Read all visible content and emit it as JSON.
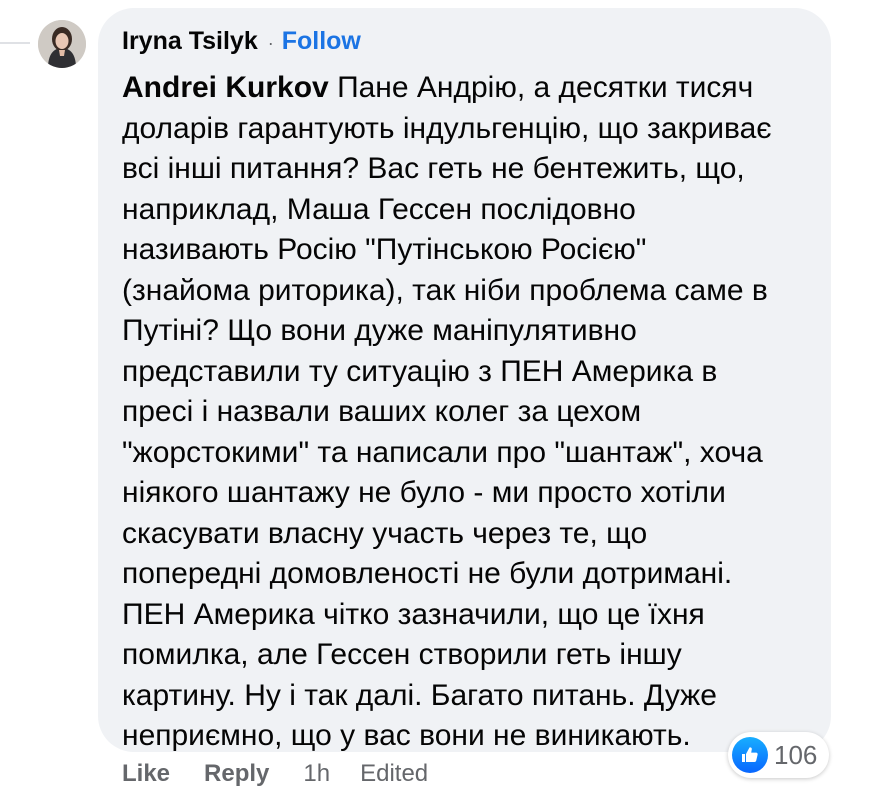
{
  "comment": {
    "author": "Iryna Tsilyk",
    "separator": "·",
    "follow_label": "Follow",
    "mention": "Andrei Kurkov",
    "lines": [
      "Пане Андрію, а десятки тисяч",
      "доларів гарантують індульгенцію, що закриває",
      "всі інші питання? Вас геть не бентежить, що,",
      "наприклад, Маша Гессен послідовно",
      "називають Росію \"Путінською Росією\"",
      "(знайома риторика), так ніби проблема саме в",
      "Путіні? Що вони дуже маніпулятивно",
      "представили ту ситуацію з ПЕН Америка в",
      "пресі і назвали ваших колег за цехом",
      "\"жорстокими\" та написали про \"шантаж\", хоча",
      "ніякого шантажу не було - ми просто хотіли",
      "скасувати власну участь через те, що",
      "попередні домовленості не були дотримані.",
      "ПЕН Америка чітко зазначили, що це їхня",
      "помилка, але Гессен створили геть іншу",
      "картину. Ну і так далі. Багато питань. Дуже",
      "неприємно, що у вас вони не виникають."
    ]
  },
  "reactions": {
    "icon": "like-thumb-icon",
    "count": "106"
  },
  "actions": {
    "like": "Like",
    "reply": "Reply",
    "time": "1h",
    "edited": "Edited"
  },
  "colors": {
    "bubble": "#f0f2f5",
    "follow": "#1b74e4",
    "muted": "#65676b",
    "text": "#050505"
  }
}
